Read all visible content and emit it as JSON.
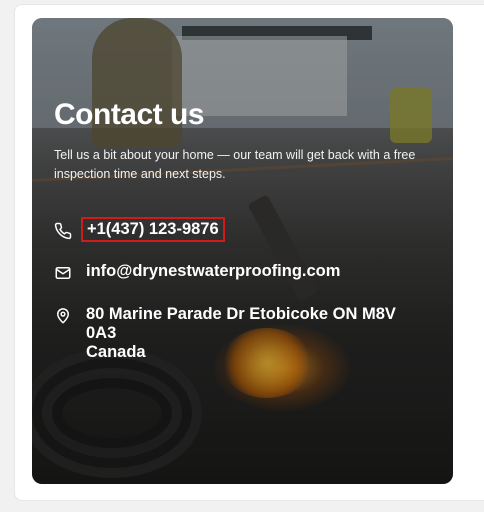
{
  "contact": {
    "title": "Contact us",
    "description": "Tell us a bit about your home — our team will get back with a free inspection time and next steps.",
    "phone": "+1(437) 123-9876",
    "email": "info@drynestwaterproofing.com",
    "address": {
      "line1": "80 Marine Parade Dr Etobicoke ON M8V",
      "line2": "0A3",
      "line3": "Canada"
    },
    "icons": {
      "phone": "phone-icon",
      "email": "mail-icon",
      "address": "map-pin-icon"
    },
    "colors": {
      "text": "#ffffff",
      "highlight": "#d11a1a"
    }
  }
}
